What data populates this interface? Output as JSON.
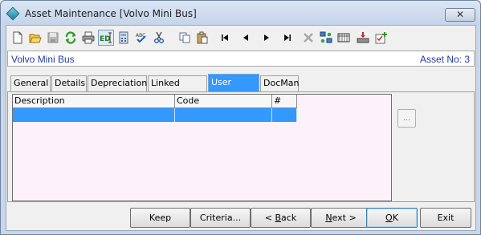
{
  "window": {
    "title": "Asset Maintenance  [Volvo Mini Bus]",
    "close_glyph": "✕"
  },
  "toolbar": {
    "items": [
      {
        "name": "new-icon"
      },
      {
        "name": "open-icon"
      },
      {
        "name": "save-icon"
      },
      {
        "name": "refresh-icon"
      },
      {
        "name": "print-icon"
      },
      {
        "name": "edit-mode-icon"
      },
      {
        "name": "calculator-icon"
      },
      {
        "name": "spellcheck-icon"
      },
      {
        "name": "cut-icon"
      },
      {
        "name": "copy-icon"
      },
      {
        "name": "paste-icon"
      },
      {
        "name": "first-record-icon"
      },
      {
        "name": "previous-record-icon"
      },
      {
        "name": "next-record-icon"
      },
      {
        "name": "last-record-icon"
      },
      {
        "name": "delete-icon"
      },
      {
        "name": "network-icon"
      },
      {
        "name": "report-icon"
      },
      {
        "name": "import-icon"
      },
      {
        "name": "add-task-icon"
      }
    ]
  },
  "info": {
    "asset_name": "Volvo Mini Bus",
    "asset_no": "Asset No: 3"
  },
  "tabs": [
    {
      "label": "General"
    },
    {
      "label": "Details"
    },
    {
      "label": "Depreciation"
    },
    {
      "label": "Linked Assets"
    },
    {
      "label": "User Forms"
    },
    {
      "label": "DocMan"
    }
  ],
  "grid": {
    "columns": [
      "Description",
      "Code",
      "#"
    ]
  },
  "ellipsis_label": "...",
  "footer": {
    "keep": "Keep",
    "criteria": "Criteria...",
    "back_prefix": "< ",
    "back_accel": "B",
    "back_rest": "ack",
    "next_accel": "N",
    "next_rest": "ext >",
    "ok_accel": "O",
    "ok_rest": "K",
    "exit": "Exit"
  },
  "colors": {
    "selection": "#3399ff",
    "info_text": "#1f3aa8",
    "grid_background": "#fdf2fa"
  }
}
